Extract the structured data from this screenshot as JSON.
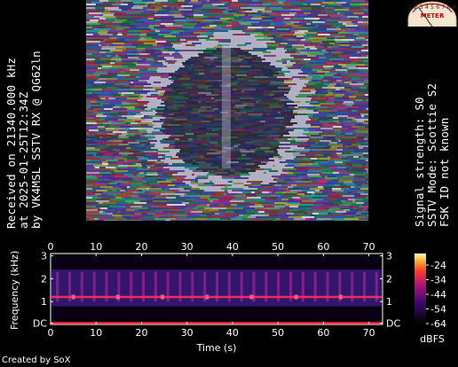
{
  "left_caption": {
    "line1": "Received on  21340.000 kHz",
    "line2": "at 2025-01-25T12:34Z",
    "line3": "by VK4MSL SSTV RX @ QG62ln"
  },
  "right_caption": {
    "line1": "Signal strength: S0",
    "line2": "SSTV Mode: Scottie S2",
    "line3": "FSK ID not known"
  },
  "meter": {
    "scale_text": "1 2 3 4 5 6 7 8 9",
    "label": "METER"
  },
  "spectrogram": {
    "time_ticks": [
      "0",
      "10",
      "20",
      "30",
      "40",
      "50",
      "60",
      "70"
    ],
    "freq_ticks": [
      "3",
      "2",
      "1",
      "DC"
    ],
    "xlabel": "Time (s)",
    "ylabel": "Frequency (kHz)",
    "colorbar_ticks": [
      "-24",
      "-34",
      "-44",
      "-54",
      "-64"
    ],
    "colorbar_unit": "dBFS",
    "colors": {
      "low": "#000000",
      "mid": "#7a1aa8",
      "high": "#ff2f4f",
      "peak": "#ffee66"
    }
  },
  "credit": "Created by SoX"
}
